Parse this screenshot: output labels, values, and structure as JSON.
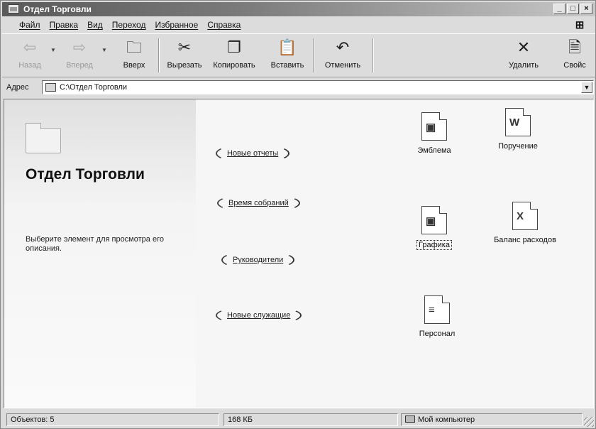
{
  "window": {
    "title": "Отдел Торговли",
    "controls": {
      "minimize": "_",
      "maximize": "□",
      "close": "×"
    }
  },
  "menu": [
    {
      "label": "Файл"
    },
    {
      "label": "Правка"
    },
    {
      "label": "Вид"
    },
    {
      "label": "Переход"
    },
    {
      "label": "Избранное"
    },
    {
      "label": "Справка"
    }
  ],
  "toolbar": {
    "back": {
      "label": "Назад",
      "icon": "back-arrow-icon",
      "enabled": false
    },
    "forward": {
      "label": "Вперед",
      "icon": "forward-arrow-icon",
      "enabled": false
    },
    "up": {
      "label": "Вверх",
      "icon": "folder-up-icon"
    },
    "cut": {
      "label": "Вырезать",
      "icon": "scissors-icon"
    },
    "copy": {
      "label": "Копировать",
      "icon": "copy-icon"
    },
    "paste": {
      "label": "Вставить",
      "icon": "paste-icon"
    },
    "undo": {
      "label": "Отменить",
      "icon": "undo-icon"
    },
    "delete": {
      "label": "Удалить",
      "icon": "delete-x-icon"
    },
    "properties": {
      "label": "Свойс",
      "icon": "properties-icon"
    }
  },
  "address": {
    "label": "Адрес",
    "value": "C:\\Отдел Торговли"
  },
  "folder_panel": {
    "heading": "Отдел Торговли",
    "description": "Выберите элемент для просмотра его описания."
  },
  "links": [
    {
      "label": "Новые отчеты"
    },
    {
      "label": "Время собраний"
    },
    {
      "label": "Руководители"
    },
    {
      "label": "Новые служащие"
    }
  ],
  "files": [
    {
      "name": "Эмблема",
      "icon": "image-document-icon"
    },
    {
      "name": "Поручение",
      "icon": "word-document-icon"
    },
    {
      "name": "Графика",
      "icon": "image-document-icon",
      "selected": true
    },
    {
      "name": "Баланс расходов",
      "icon": "excel-spreadsheet-icon"
    },
    {
      "name": "Персонал",
      "icon": "text-document-icon"
    }
  ],
  "status": {
    "objects": "Объектов: 5",
    "size": "168 КБ",
    "location": "Мой компьютер"
  }
}
